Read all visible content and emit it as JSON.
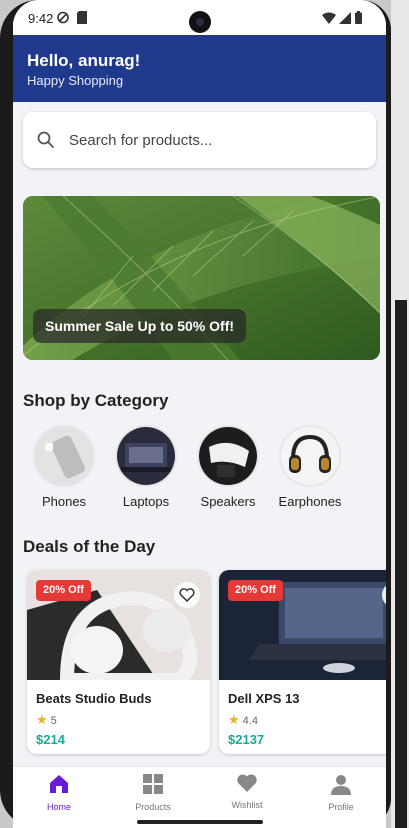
{
  "status": {
    "time": "9:42"
  },
  "header": {
    "greeting": "Hello, anurag!",
    "subtitle": "Happy Shopping"
  },
  "search": {
    "placeholder": "Search for products..."
  },
  "banner": {
    "label": "Summer Sale Up to 50% Off!"
  },
  "categories_section": {
    "title": "Shop by Category",
    "items": [
      {
        "label": "Phones"
      },
      {
        "label": "Laptops"
      },
      {
        "label": "Speakers"
      },
      {
        "label": "Earphones"
      }
    ]
  },
  "deals_section": {
    "title": "Deals of the Day",
    "items": [
      {
        "badge": "20% Off",
        "name": "Beats Studio Buds",
        "rating": "5",
        "price": "$214"
      },
      {
        "badge": "20% Off",
        "name": "Dell XPS 13",
        "rating": "4.4",
        "price": "$2137"
      }
    ]
  },
  "nav": {
    "items": [
      {
        "label": "Home",
        "icon": "home-icon"
      },
      {
        "label": "Products",
        "icon": "grid-icon"
      },
      {
        "label": "Wishlist",
        "icon": "heart-icon"
      },
      {
        "label": "Profile",
        "icon": "person-icon"
      }
    ],
    "active": "Home"
  },
  "colors": {
    "header_bg": "#1f3a8c",
    "accent": "#6a1bd6",
    "price": "#1aa89c",
    "badge": "#e53935"
  }
}
